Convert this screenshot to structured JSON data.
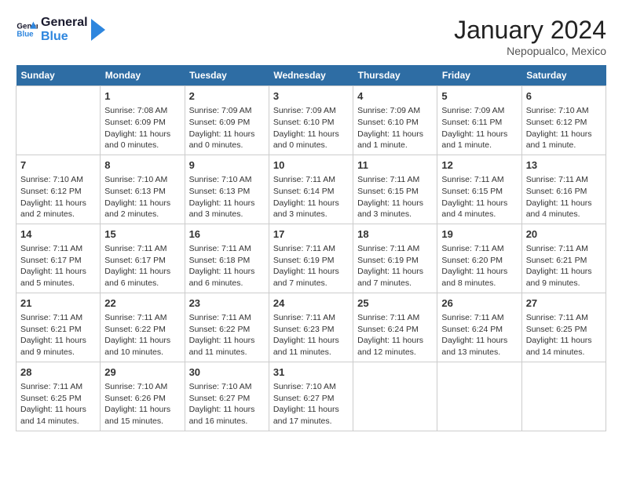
{
  "header": {
    "logo_line1": "General",
    "logo_line2": "Blue",
    "month_year": "January 2024",
    "location": "Nepopualco, Mexico"
  },
  "weekdays": [
    "Sunday",
    "Monday",
    "Tuesday",
    "Wednesday",
    "Thursday",
    "Friday",
    "Saturday"
  ],
  "weeks": [
    [
      {
        "day": "",
        "info": ""
      },
      {
        "day": "1",
        "info": "Sunrise: 7:08 AM\nSunset: 6:09 PM\nDaylight: 11 hours\nand 0 minutes."
      },
      {
        "day": "2",
        "info": "Sunrise: 7:09 AM\nSunset: 6:09 PM\nDaylight: 11 hours\nand 0 minutes."
      },
      {
        "day": "3",
        "info": "Sunrise: 7:09 AM\nSunset: 6:10 PM\nDaylight: 11 hours\nand 0 minutes."
      },
      {
        "day": "4",
        "info": "Sunrise: 7:09 AM\nSunset: 6:10 PM\nDaylight: 11 hours\nand 1 minute."
      },
      {
        "day": "5",
        "info": "Sunrise: 7:09 AM\nSunset: 6:11 PM\nDaylight: 11 hours\nand 1 minute."
      },
      {
        "day": "6",
        "info": "Sunrise: 7:10 AM\nSunset: 6:12 PM\nDaylight: 11 hours\nand 1 minute."
      }
    ],
    [
      {
        "day": "7",
        "info": "Sunrise: 7:10 AM\nSunset: 6:12 PM\nDaylight: 11 hours\nand 2 minutes."
      },
      {
        "day": "8",
        "info": "Sunrise: 7:10 AM\nSunset: 6:13 PM\nDaylight: 11 hours\nand 2 minutes."
      },
      {
        "day": "9",
        "info": "Sunrise: 7:10 AM\nSunset: 6:13 PM\nDaylight: 11 hours\nand 3 minutes."
      },
      {
        "day": "10",
        "info": "Sunrise: 7:11 AM\nSunset: 6:14 PM\nDaylight: 11 hours\nand 3 minutes."
      },
      {
        "day": "11",
        "info": "Sunrise: 7:11 AM\nSunset: 6:15 PM\nDaylight: 11 hours\nand 3 minutes."
      },
      {
        "day": "12",
        "info": "Sunrise: 7:11 AM\nSunset: 6:15 PM\nDaylight: 11 hours\nand 4 minutes."
      },
      {
        "day": "13",
        "info": "Sunrise: 7:11 AM\nSunset: 6:16 PM\nDaylight: 11 hours\nand 4 minutes."
      }
    ],
    [
      {
        "day": "14",
        "info": "Sunrise: 7:11 AM\nSunset: 6:17 PM\nDaylight: 11 hours\nand 5 minutes."
      },
      {
        "day": "15",
        "info": "Sunrise: 7:11 AM\nSunset: 6:17 PM\nDaylight: 11 hours\nand 6 minutes."
      },
      {
        "day": "16",
        "info": "Sunrise: 7:11 AM\nSunset: 6:18 PM\nDaylight: 11 hours\nand 6 minutes."
      },
      {
        "day": "17",
        "info": "Sunrise: 7:11 AM\nSunset: 6:19 PM\nDaylight: 11 hours\nand 7 minutes."
      },
      {
        "day": "18",
        "info": "Sunrise: 7:11 AM\nSunset: 6:19 PM\nDaylight: 11 hours\nand 7 minutes."
      },
      {
        "day": "19",
        "info": "Sunrise: 7:11 AM\nSunset: 6:20 PM\nDaylight: 11 hours\nand 8 minutes."
      },
      {
        "day": "20",
        "info": "Sunrise: 7:11 AM\nSunset: 6:21 PM\nDaylight: 11 hours\nand 9 minutes."
      }
    ],
    [
      {
        "day": "21",
        "info": "Sunrise: 7:11 AM\nSunset: 6:21 PM\nDaylight: 11 hours\nand 9 minutes."
      },
      {
        "day": "22",
        "info": "Sunrise: 7:11 AM\nSunset: 6:22 PM\nDaylight: 11 hours\nand 10 minutes."
      },
      {
        "day": "23",
        "info": "Sunrise: 7:11 AM\nSunset: 6:22 PM\nDaylight: 11 hours\nand 11 minutes."
      },
      {
        "day": "24",
        "info": "Sunrise: 7:11 AM\nSunset: 6:23 PM\nDaylight: 11 hours\nand 11 minutes."
      },
      {
        "day": "25",
        "info": "Sunrise: 7:11 AM\nSunset: 6:24 PM\nDaylight: 11 hours\nand 12 minutes."
      },
      {
        "day": "26",
        "info": "Sunrise: 7:11 AM\nSunset: 6:24 PM\nDaylight: 11 hours\nand 13 minutes."
      },
      {
        "day": "27",
        "info": "Sunrise: 7:11 AM\nSunset: 6:25 PM\nDaylight: 11 hours\nand 14 minutes."
      }
    ],
    [
      {
        "day": "28",
        "info": "Sunrise: 7:11 AM\nSunset: 6:25 PM\nDaylight: 11 hours\nand 14 minutes."
      },
      {
        "day": "29",
        "info": "Sunrise: 7:10 AM\nSunset: 6:26 PM\nDaylight: 11 hours\nand 15 minutes."
      },
      {
        "day": "30",
        "info": "Sunrise: 7:10 AM\nSunset: 6:27 PM\nDaylight: 11 hours\nand 16 minutes."
      },
      {
        "day": "31",
        "info": "Sunrise: 7:10 AM\nSunset: 6:27 PM\nDaylight: 11 hours\nand 17 minutes."
      },
      {
        "day": "",
        "info": ""
      },
      {
        "day": "",
        "info": ""
      },
      {
        "day": "",
        "info": ""
      }
    ]
  ]
}
